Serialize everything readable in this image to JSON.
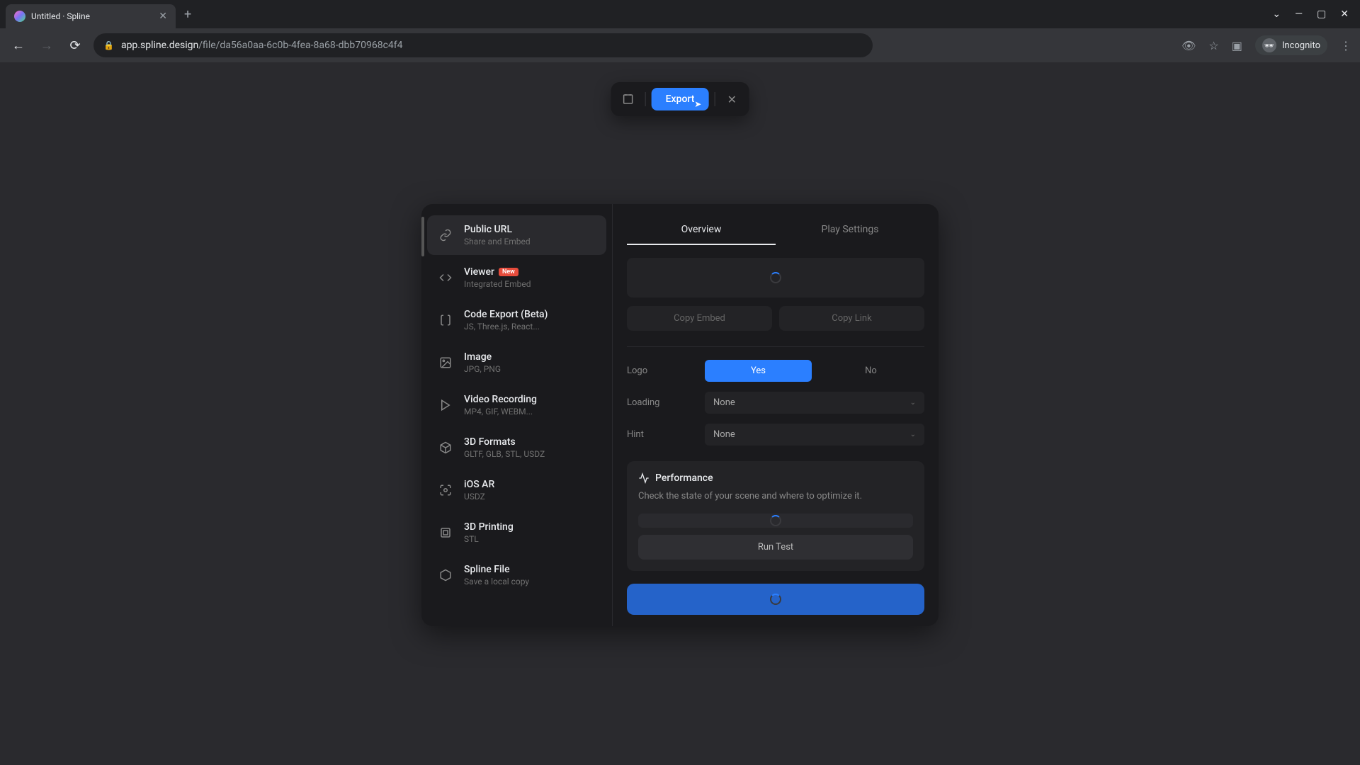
{
  "browser": {
    "tab_title": "Untitled · Spline",
    "url_domain": "app.spline.design",
    "url_path": "/file/da56a0aa-6c0b-4fea-8a68-dbb70968c4f4",
    "incognito_label": "Incognito"
  },
  "toolbar": {
    "export_label": "Export"
  },
  "sidebar": {
    "options": [
      {
        "title": "Public URL",
        "subtitle": "Share and Embed",
        "badge": ""
      },
      {
        "title": "Viewer",
        "subtitle": "Integrated Embed",
        "badge": "New"
      },
      {
        "title": "Code Export (Beta)",
        "subtitle": "JS, Three.js, React...",
        "badge": ""
      },
      {
        "title": "Image",
        "subtitle": "JPG, PNG",
        "badge": ""
      },
      {
        "title": "Video Recording",
        "subtitle": "MP4, GIF, WEBM...",
        "badge": ""
      },
      {
        "title": "3D Formats",
        "subtitle": "GLTF, GLB, STL, USDZ",
        "badge": ""
      },
      {
        "title": "iOS AR",
        "subtitle": "USDZ",
        "badge": ""
      },
      {
        "title": "3D Printing",
        "subtitle": "STL",
        "badge": ""
      },
      {
        "title": "Spline File",
        "subtitle": "Save a local copy",
        "badge": ""
      }
    ]
  },
  "main": {
    "tabs": {
      "overview": "Overview",
      "play_settings": "Play Settings"
    },
    "copy_embed": "Copy Embed",
    "copy_link": "Copy Link",
    "settings": {
      "logo_label": "Logo",
      "logo_yes": "Yes",
      "logo_no": "No",
      "loading_label": "Loading",
      "loading_value": "None",
      "hint_label": "Hint",
      "hint_value": "None"
    },
    "performance": {
      "title": "Performance",
      "description": "Check the state of your scene and where to optimize it.",
      "run_test": "Run Test"
    }
  }
}
